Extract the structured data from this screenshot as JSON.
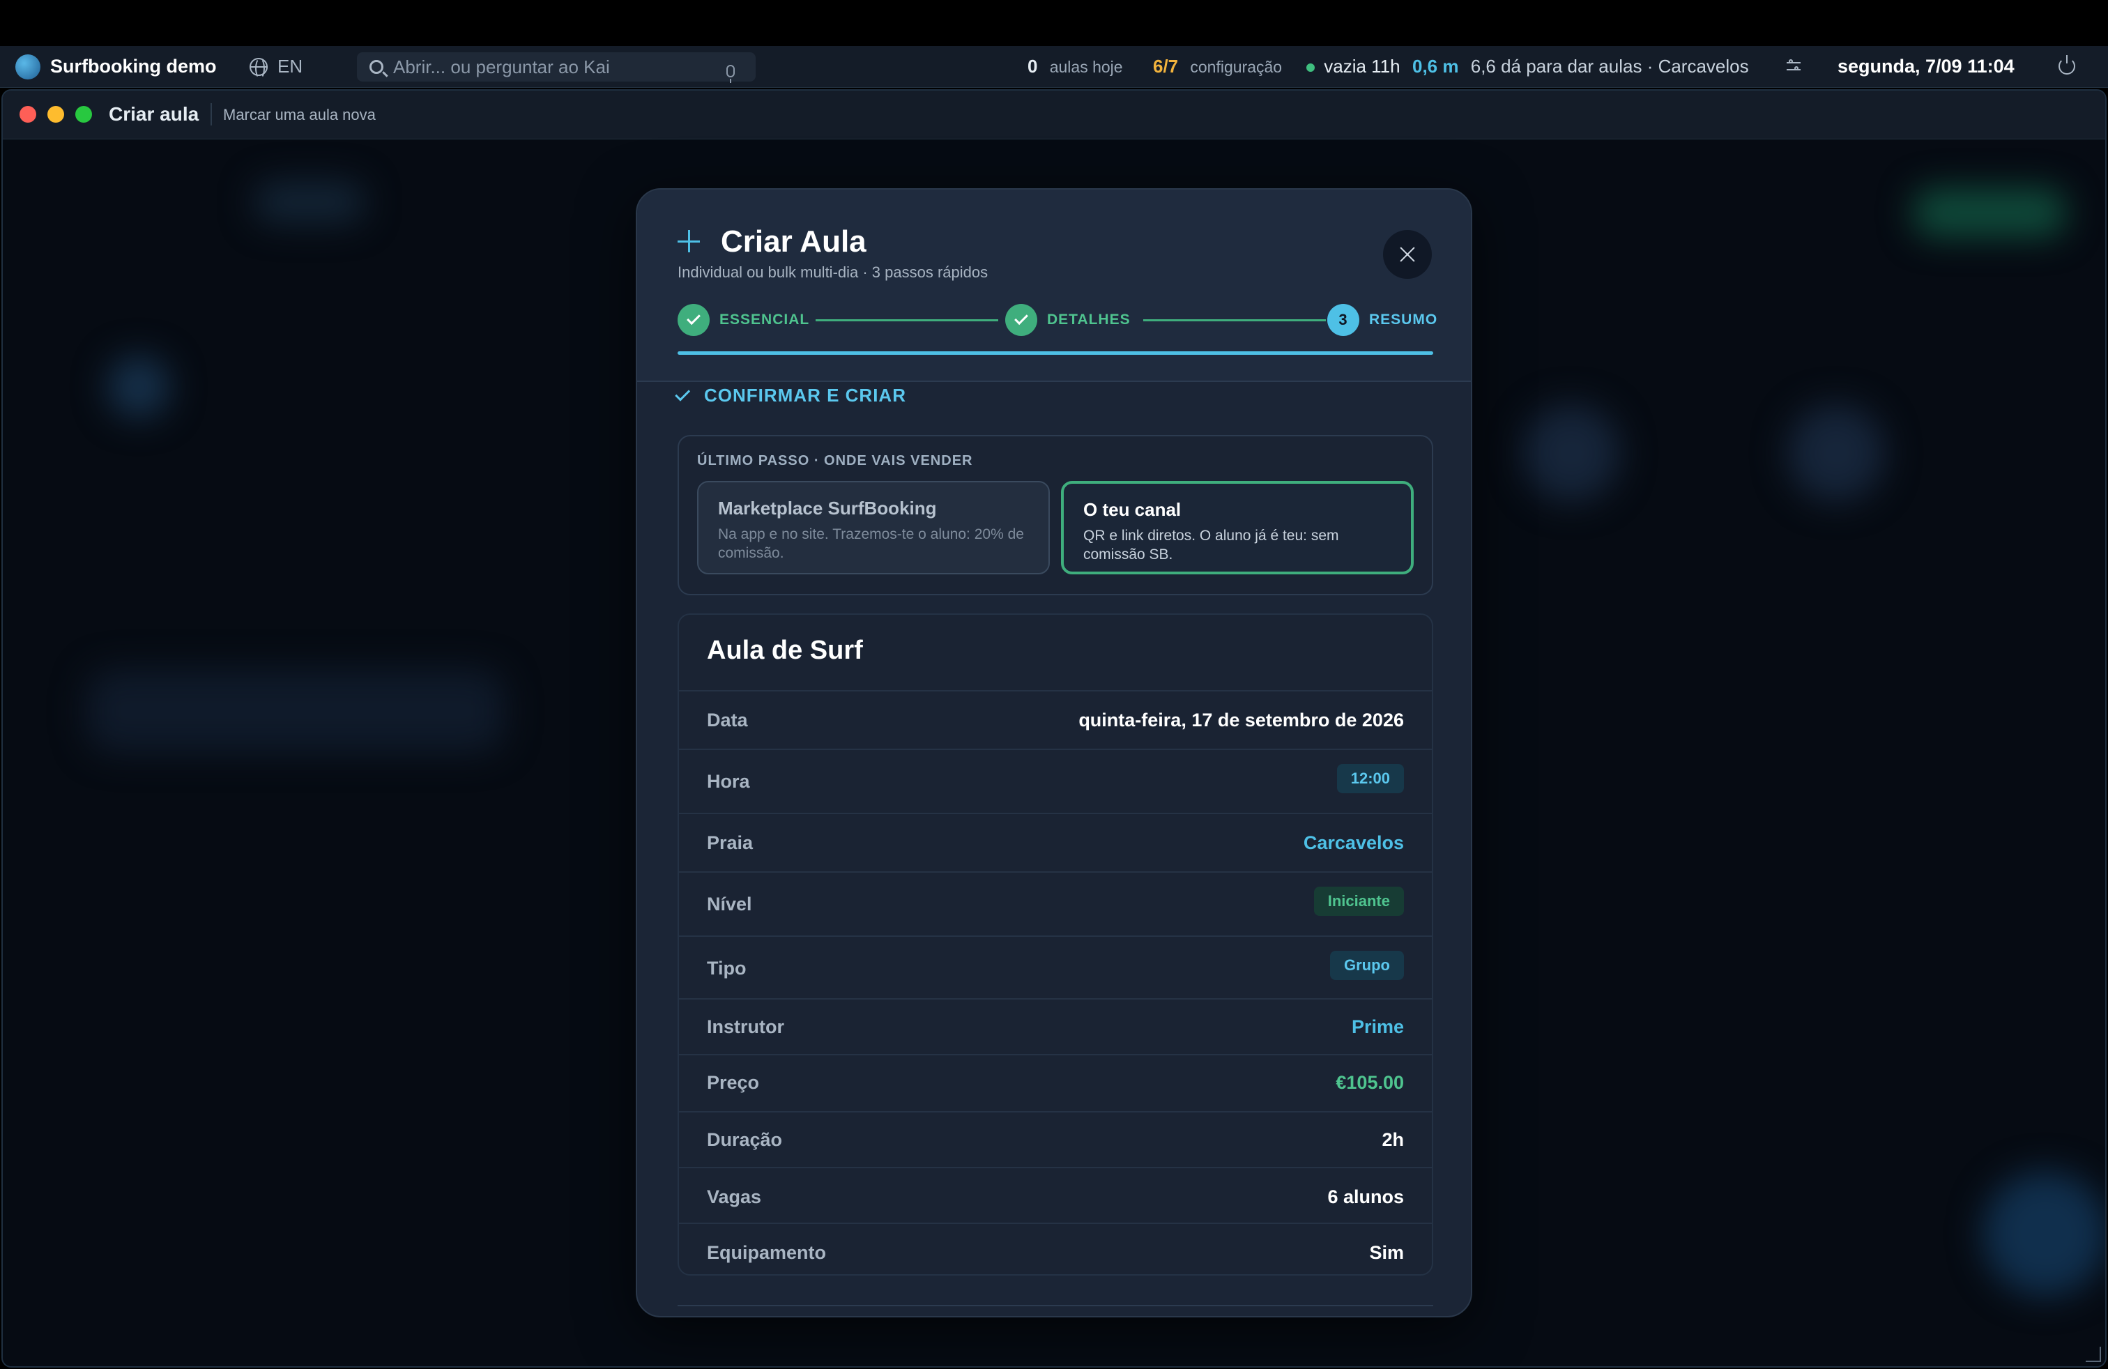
{
  "menubar": {
    "app_name": "Surfbooking demo",
    "lang": "EN",
    "search_placeholder": "Abrir... ou perguntar ao Kai",
    "stats": {
      "lessons_today_num": "0",
      "lessons_today_label": "aulas hoje",
      "config_num": "6/7",
      "config_label": "configuração",
      "tide": "vazia 11h",
      "wave": "0,6 m",
      "forecast": "6,6 dá para dar aulas · Carcavelos"
    },
    "datetime": "segunda, 7/09 11:04"
  },
  "window": {
    "title": "Criar aula",
    "subtitle": "Marcar uma aula nova"
  },
  "modal": {
    "title": "Criar Aula",
    "subtitle": "Individual ou bulk multi-dia · 3 passos rápidos",
    "steps": [
      {
        "label": "ESSENCIAL",
        "state": "done"
      },
      {
        "label": "DETALHES",
        "state": "done"
      },
      {
        "number": "3",
        "label": "RESUMO",
        "state": "current"
      }
    ],
    "confirm_heading": "CONFIRMAR E CRIAR",
    "channel": {
      "heading": "ÚLTIMO PASSO · ONDE VAIS VENDER",
      "options": [
        {
          "title": "Marketplace SurfBooking",
          "desc": "Na app e no site. Trazemos-te o aluno: 20% de comissão.",
          "selected": false
        },
        {
          "title": "O teu canal",
          "desc": "QR e link diretos. O aluno já é teu: sem comissão SB.",
          "selected": true
        }
      ]
    },
    "summary": {
      "title": "Aula de Surf",
      "rows": [
        {
          "key": "Data",
          "value": "quinta-feira, 17 de setembro de 2026"
        },
        {
          "key": "Hora",
          "value": "12:00"
        },
        {
          "key": "Praia",
          "value": "Carcavelos"
        },
        {
          "key": "Nível",
          "value": "Iniciante"
        },
        {
          "key": "Tipo",
          "value": "Grupo"
        },
        {
          "key": "Instrutor",
          "value": "Prime"
        },
        {
          "key": "Preço",
          "value": "€105.00"
        },
        {
          "key": "Duração",
          "value": "2h"
        },
        {
          "key": "Vagas",
          "value": "6 alunos"
        },
        {
          "key": "Equipamento",
          "value": "Sim"
        }
      ]
    }
  },
  "colors": {
    "accent_blue": "#4ec0e6",
    "accent_green": "#3fae7d",
    "config_yellow": "#f2b33d",
    "wave_blue": "#4ec0e6"
  }
}
